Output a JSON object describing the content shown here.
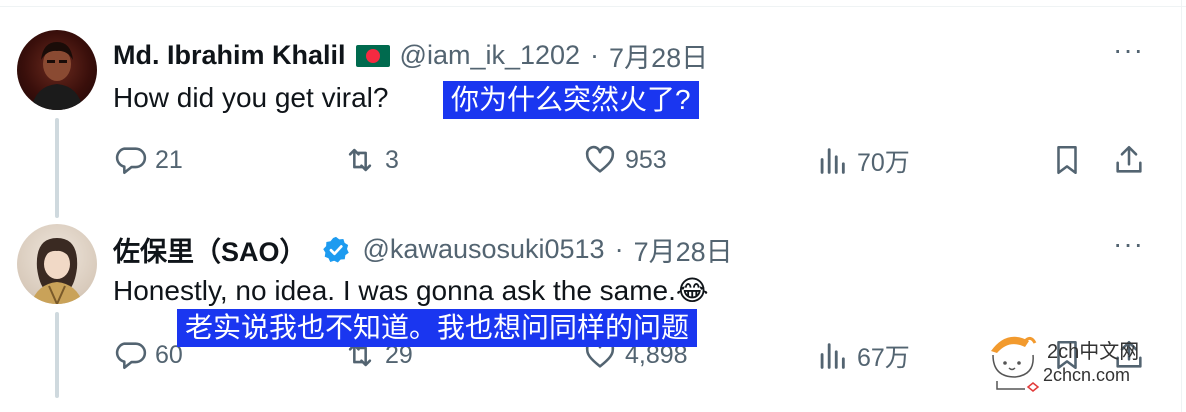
{
  "tweets": [
    {
      "name": "Md. Ibrahim Khalil",
      "handle": "@iam_ik_1202",
      "separator": "·",
      "date": "7月28日",
      "text": "How did you get viral?",
      "translation": "你为什么突然火了?",
      "replies": "21",
      "retweets": "3",
      "likes": "953",
      "views": "70万",
      "more": "···"
    },
    {
      "name": "佐保里（SAO）",
      "handle": "@kawausosuki0513",
      "separator": "·",
      "date": "7月28日",
      "text": "Honestly, no idea. I was gonna ask the same.😂",
      "translation": "老实说我也不知道。我也想问同样的问题",
      "replies": "60",
      "retweets": "29",
      "likes": "4,898",
      "views": "67万",
      "more": "···"
    }
  ],
  "watermark": {
    "line1": "2ch中文网",
    "line2": "2chcn.com"
  },
  "colors": {
    "translation_bg": "#1a36f0",
    "verified": "#1d9bf0",
    "muted": "#536471"
  }
}
